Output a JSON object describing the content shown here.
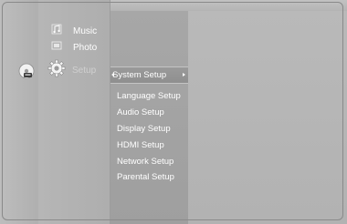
{
  "main_menu": {
    "items": [
      {
        "label": "Music",
        "icon": "music-note-icon"
      },
      {
        "label": "Photo",
        "icon": "photo-icon"
      },
      {
        "label": "Setup",
        "icon": "gear-icon"
      }
    ],
    "disc_icon": "disc-icon"
  },
  "submenu": {
    "selected": "System Setup",
    "items": [
      "Language Setup",
      "Audio Setup",
      "Display Setup",
      "HDMI Setup",
      "Network Setup",
      "Parental Setup"
    ]
  },
  "colors": {
    "text": "#ffffff",
    "setup_label": "#d0d0d0",
    "highlight": "#939393",
    "background": "#adadad"
  }
}
